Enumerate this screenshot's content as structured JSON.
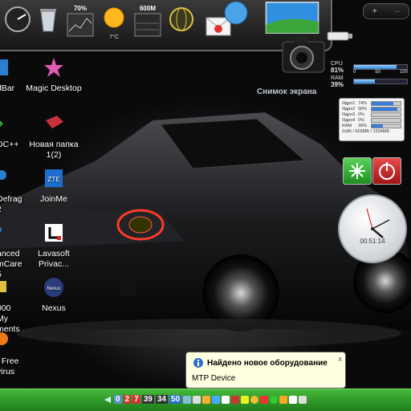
{
  "dock": {
    "items": [
      {
        "name": "gauge",
        "label": ""
      },
      {
        "name": "recycle-bin",
        "label": ""
      },
      {
        "name": "cpu-meter",
        "value": "70%"
      },
      {
        "name": "weather",
        "value": "7°C"
      },
      {
        "name": "memory-meter",
        "value": "600M"
      },
      {
        "name": "network-globe",
        "label": ""
      },
      {
        "name": "mail",
        "label": ""
      }
    ]
  },
  "top_right_widget": {
    "plus": "+",
    "dots": "··"
  },
  "screenshot_label": "Снимок экрана",
  "cpu_ram": {
    "cpu_label": "CPU",
    "cpu_value": "81%",
    "cpu_fraction": 0.81,
    "ticks": [
      "0",
      "50",
      "100"
    ],
    "ram_label": "RAM",
    "ram_value": "39%",
    "ram_fraction": 0.39
  },
  "drives": {
    "rows": [
      {
        "name": "Ядро1",
        "value": "74%",
        "fraction": 0.74
      },
      {
        "name": "Ядро2",
        "value": "90%",
        "fraction": 0.9
      },
      {
        "name": "Ядро3",
        "value": "0%",
        "fraction": 0.0
      },
      {
        "name": "Ядро4",
        "value": "0%",
        "fraction": 0.0
      },
      {
        "name": "RAM",
        "value": "39%",
        "fraction": 0.39
      }
    ],
    "footer": "2x86 / 603MB / 1534MB"
  },
  "clock": {
    "time": "00:51:14"
  },
  "desktop_icons": [
    {
      "label": "Magic Desktop"
    },
    {
      "label": "Новая папка\n1(2)"
    },
    {
      "label": "JoinMe"
    },
    {
      "label": "Lavasoft\nPrivac..."
    },
    {
      "label": "Nexus"
    }
  ],
  "left_icons": [
    {
      "label": "dBar"
    },
    {
      "label": "DC++"
    },
    {
      "label": "Defrag\n2"
    },
    {
      "label": "anced\nmCare 5"
    },
    {
      "label": "000 My\nments"
    },
    {
      "label": "! Free\nvirus"
    }
  ],
  "notification": {
    "title": "Найдено новое оборудование",
    "body": "MTP Device",
    "close": "x"
  },
  "tray": {
    "numbers": [
      "0",
      "2",
      "7",
      "39",
      "34",
      "50"
    ]
  },
  "colors": {
    "taskbar": "#2f9a28",
    "accent": "#3b7dd8"
  }
}
